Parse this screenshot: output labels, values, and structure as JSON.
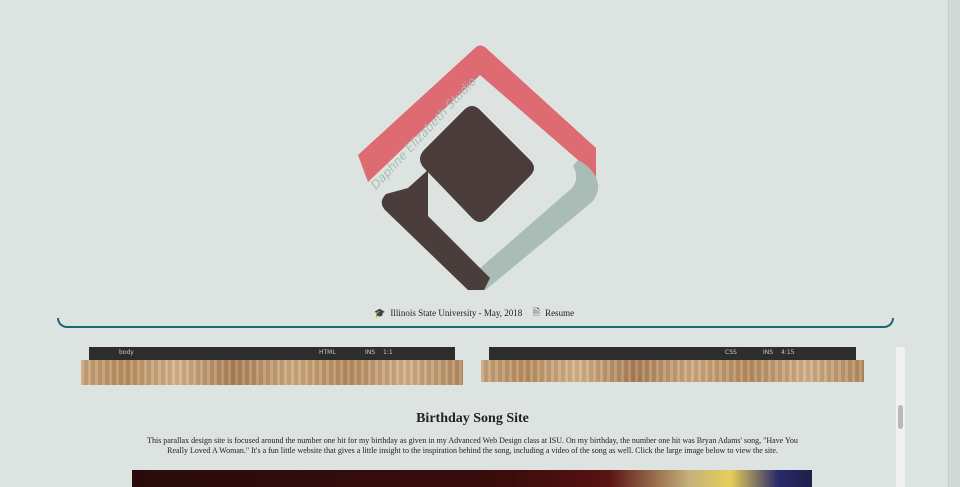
{
  "logo": {
    "text": "Daphne Elizabeth Studio",
    "colors": {
      "pink": "#de6a72",
      "sage": "#a9bcb5",
      "brown": "#4a3d3b"
    }
  },
  "header": {
    "education": "Illinois State University - May, 2018",
    "education_icon": "graduation-cap-icon",
    "resume_label": "Resume",
    "resume_icon": "pdf-file-icon",
    "accent_color": "#1b6870"
  },
  "thumbnails": [
    {
      "status_left": "body",
      "mode": "HTML",
      "ins": "INS",
      "pos": "1:1"
    },
    {
      "status_left": "",
      "mode": "CSS",
      "ins": "INS",
      "pos": "4:15"
    }
  ],
  "project": {
    "title": "Birthday Song Site",
    "description": "This parallax design site is focused around the number one hit for my birthday as given in my Advanced Web Design class at ISU. On my birthday, the number one hit was Bryan Adams' song, \"Have You Really Loved A Woman.\" It's a fun little website that gives a little insight to the inspiration behind the song, including a video of the song as well. Click the large image below to view the site."
  }
}
